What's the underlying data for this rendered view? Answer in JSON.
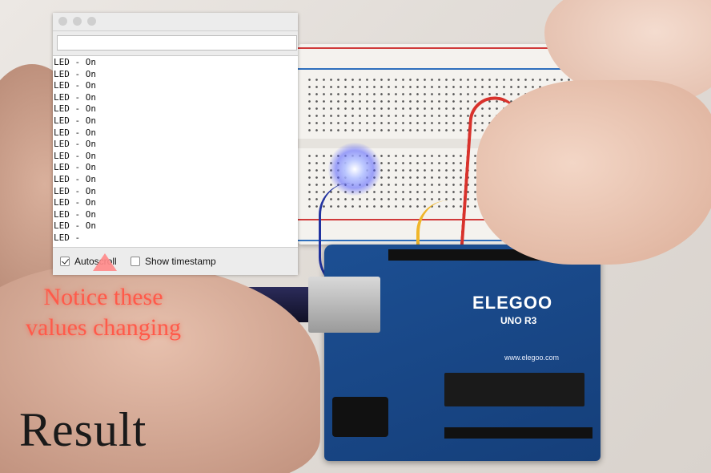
{
  "serial_monitor": {
    "send_input_value": "",
    "lines": [
      "LED - On",
      "LED - On",
      "LED - On",
      "LED - On",
      "LED - On",
      "LED - On",
      "LED - On",
      "LED - On",
      "LED - On",
      "LED - On",
      "LED - On",
      "LED - On",
      "LED - On",
      "LED - On",
      "LED - On",
      "LED -"
    ],
    "autoscroll_label": "Autoscroll",
    "autoscroll_checked": true,
    "timestamp_label": "Show timestamp",
    "timestamp_checked": false
  },
  "board": {
    "brand": "ELEGOO",
    "model": "UNO R3",
    "url": "www.elegoo.com"
  },
  "annotation": {
    "text_line1": "Notice these",
    "text_line2": "values changing",
    "arrow_color": "#ff8a8a",
    "text_color": "#ff5a4a"
  },
  "caption": "Result",
  "icons": [
    "checkbox-checked-icon",
    "checkbox-empty-icon",
    "up-arrow-icon",
    "window-control-icon"
  ]
}
